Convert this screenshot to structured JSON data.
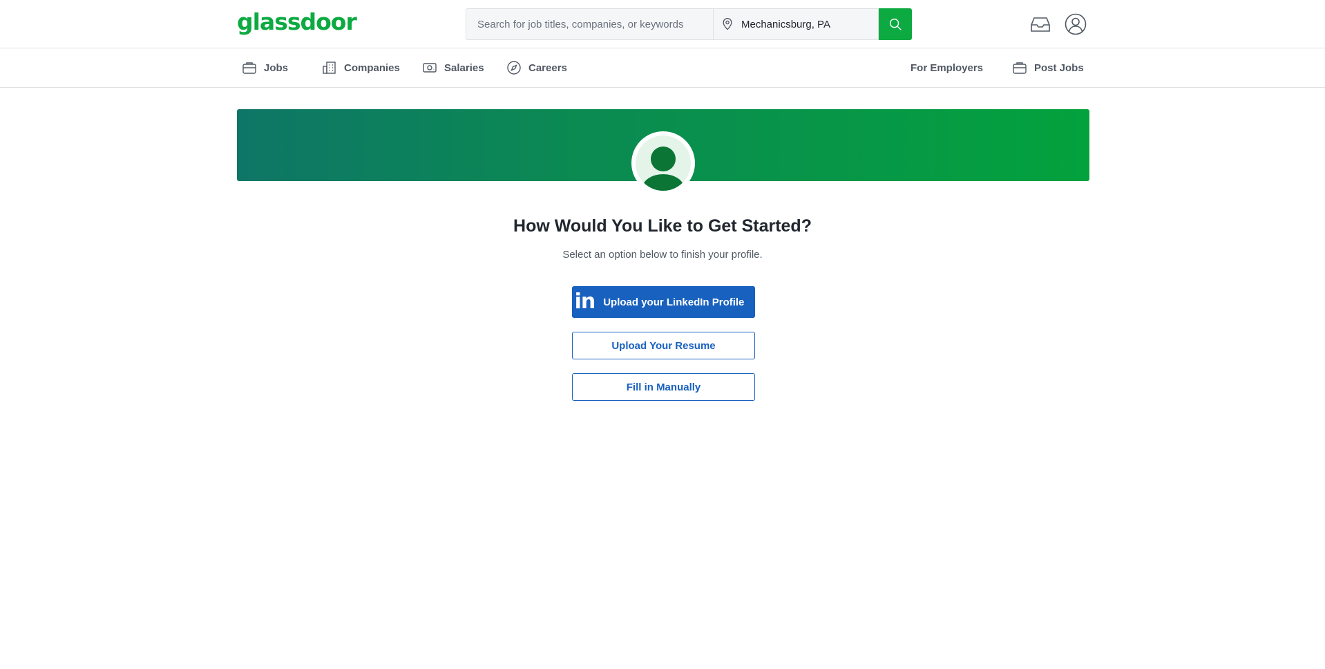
{
  "header": {
    "logo_text": "glassdoor",
    "search_placeholder": "Search for job titles, companies, or keywords",
    "location_value": "Mechanicsburg, PA"
  },
  "nav": {
    "items": [
      {
        "label": "Jobs",
        "icon": "briefcase-icon"
      },
      {
        "label": "Companies",
        "icon": "building-icon"
      },
      {
        "label": "Salaries",
        "icon": "money-icon"
      },
      {
        "label": "Careers",
        "icon": "compass-icon"
      }
    ],
    "right": [
      {
        "label": "For Employers"
      },
      {
        "label": "Post Jobs",
        "icon": "briefcase-icon"
      }
    ]
  },
  "main": {
    "title": "How Would You Like to Get Started?",
    "subtitle": "Select an option below to finish your profile.",
    "linkedin_logo": "in",
    "linkedin_button": "Upload your LinkedIn Profile",
    "resume_button": "Upload Your Resume",
    "manual_button": "Fill in Manually"
  },
  "colors": {
    "brand_green": "#0caa41",
    "primary_blue": "#1861bf",
    "banner_start": "#0e7666",
    "banner_end": "#03a23d"
  }
}
